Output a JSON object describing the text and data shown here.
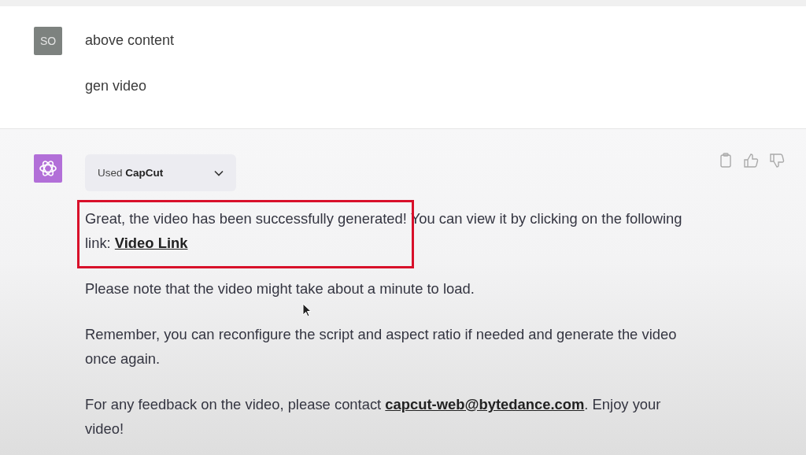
{
  "user_message": {
    "avatar": "SO",
    "lines": [
      "above content",
      "gen video"
    ]
  },
  "assistant_message": {
    "tool_dropdown": {
      "prefix": "Used",
      "tool": "CapCut",
      "expanded": false
    },
    "paragraphs": [
      {
        "highlighted": true,
        "segments": [
          {
            "kind": "text",
            "text": "Great, the video has been successfully generated! You can view it by clicking on the following link: "
          },
          {
            "kind": "link",
            "text": "Video Link"
          }
        ]
      },
      {
        "highlighted": false,
        "segments": [
          {
            "kind": "text",
            "text": "Please note that the video might take about a minute to load."
          }
        ]
      },
      {
        "highlighted": false,
        "segments": [
          {
            "kind": "text",
            "text": "Remember, you can reconfigure the script and aspect ratio if needed and generate the video once again."
          }
        ]
      },
      {
        "highlighted": false,
        "segments": [
          {
            "kind": "text",
            "text": "For any feedback on the video, please contact "
          },
          {
            "kind": "link",
            "text": "capcut-web@bytedance.com"
          },
          {
            "kind": "text",
            "text": ". Enjoy your video!"
          }
        ]
      }
    ]
  }
}
